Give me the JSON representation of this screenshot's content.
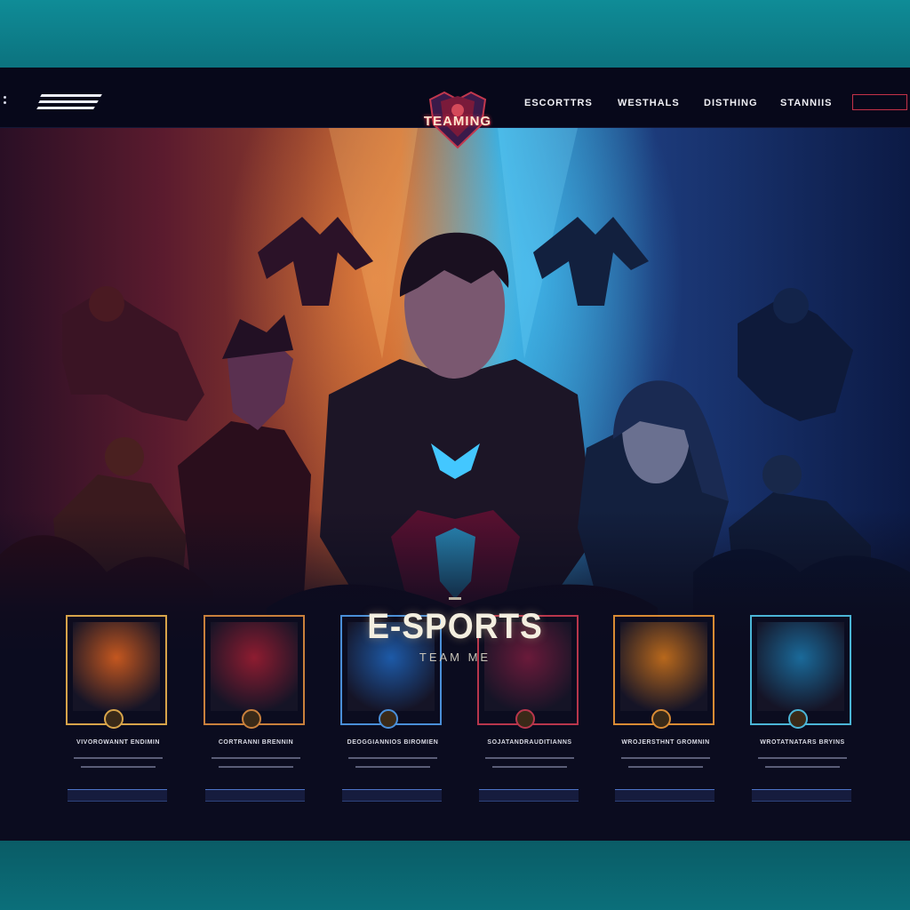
{
  "brand": {
    "logo_text": "TEAMING"
  },
  "nav": {
    "items": [
      {
        "label": "ESCORTTRS"
      },
      {
        "label": "WESTHALS"
      },
      {
        "label": "DISTHING"
      },
      {
        "label": "STANNIIS"
      }
    ]
  },
  "hero": {
    "title": "E-SPORTS",
    "subtitle": "TEAM ME"
  },
  "cards": [
    {
      "name": "VIVOROWANNT ENDIMIN",
      "accent": "#d7a44a",
      "art_color": "#c4571f"
    },
    {
      "name": "CORTRANNI BRENNIN",
      "accent": "#c9803c",
      "art_color": "#8e1c30"
    },
    {
      "name": "DEOGGIANNIOS BIROMIEN",
      "accent": "#4a8fd8",
      "art_color": "#1d5aa8"
    },
    {
      "name": "SOJATANDRAUDITIANNS",
      "accent": "#b8364c",
      "art_color": "#6a1a3a"
    },
    {
      "name": "WROJERSTHNT GROMNIN",
      "accent": "#d98b34",
      "art_color": "#b8681c"
    },
    {
      "name": "WROTATNATARS BRYINS",
      "accent": "#4bb5d6",
      "art_color": "#1a6a9a"
    }
  ],
  "colors": {
    "page_bg": "#0b0c1f",
    "teal_border": "#0c7480",
    "card_border": "#c9a15a",
    "button_blue": "#4e74c8"
  }
}
